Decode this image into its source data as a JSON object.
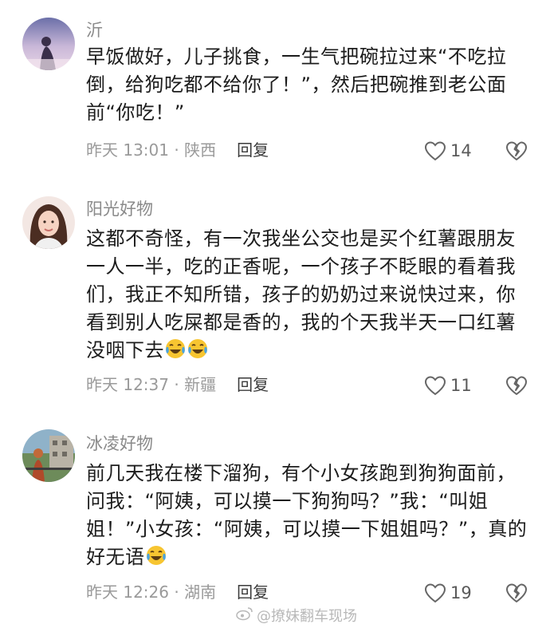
{
  "comments": [
    {
      "username": "沂",
      "text": "早饭做好，儿子挑食，一生气把碗拉过来“不吃拉倒，给狗吃都不给你了！”，然后把碗推到老公面前“你吃！”",
      "meta": "昨天 13:01 · 陕西",
      "reply_label": "回复",
      "likes": "14"
    },
    {
      "username": "阳光好物",
      "text": "这都不奇怪，有一次我坐公交也是买个红薯跟朋友一人一半，吃的正香呢，一个孩子不眨眼的看着我们，我正不知所错，孩子的奶奶过来说快过来，你看到别人吃屎都是香的，我的个天我半天一口红薯没咽下去",
      "meta": "昨天 12:37 · 新疆",
      "reply_label": "回复",
      "likes": "11"
    },
    {
      "username": "冰凌好物",
      "text": "前几天我在楼下溜狗，有个小女孩跑到狗狗面前，问我：“阿姨，可以摸一下狗狗吗？”我：“叫姐姐！”小女孩：“阿姨，可以摸一下姐姐吗？”，真的好无语",
      "meta": "昨天 12:26 · 湖南",
      "reply_label": "回复",
      "likes": "19"
    }
  ],
  "watermark": "@撩妹翻车现场",
  "icons": [
    "heart-outline-icon",
    "broken-heart-icon",
    "laughing-crying-emoji",
    "weibo-logo-icon"
  ],
  "colors": {
    "emoji": "#f7c531",
    "tear": "#4aa3df",
    "muted": "#9a9a9a"
  }
}
